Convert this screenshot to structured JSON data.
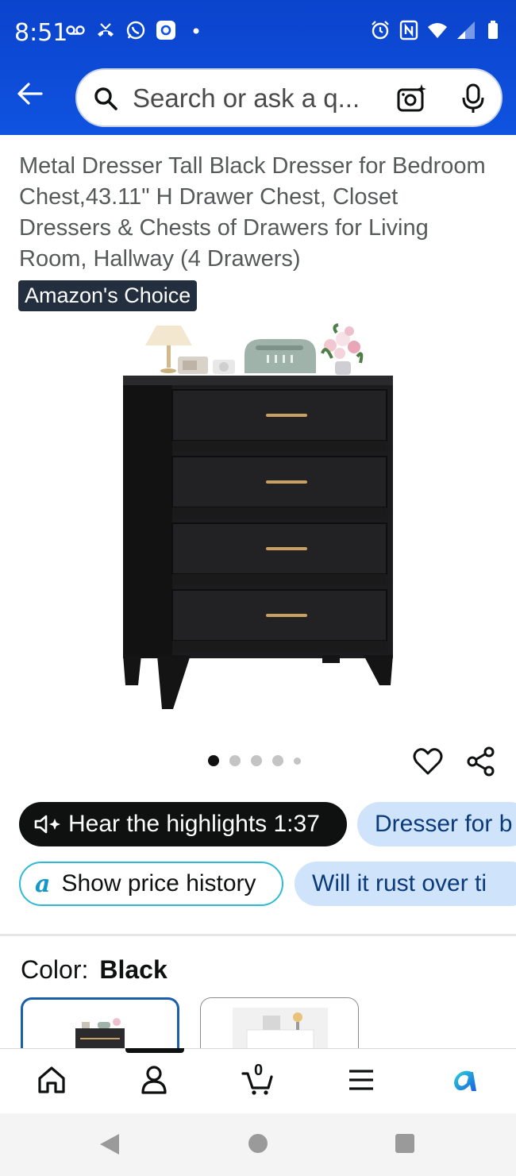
{
  "status_bar": {
    "time": "8:51",
    "left_icons": [
      "voicemail-icon",
      "missed-call-icon",
      "whatsapp-icon",
      "app-notification-icon",
      "dot-icon"
    ],
    "right_icons": [
      "alarm-icon",
      "nfc-icon",
      "wifi-icon",
      "signal-icon",
      "battery-icon"
    ]
  },
  "header": {
    "search_placeholder": "Search or ask a q...",
    "accent_color": "#0f53e0"
  },
  "product": {
    "title": "Metal Dresser Tall Black Dresser for Bedroom Chest,43.11\" H Drawer Chest, Closet Dressers & Chests of Drawers for Living Room, Hallway (4 Drawers)",
    "badge": "Amazon's Choice",
    "image_count": 5,
    "active_image_index": 0
  },
  "pills": {
    "hear_highlights": "Hear the highlights 1:37",
    "dresser_for": "Dresser for b",
    "show_price_history": "Show price history",
    "rust_question": "Will it rust over ti"
  },
  "color_selector": {
    "label": "Color:",
    "value": "Black",
    "options": [
      "Black",
      "White"
    ]
  },
  "bottom_nav": {
    "items": [
      "home-icon",
      "account-icon",
      "cart-icon",
      "menu-icon",
      "rufus-icon"
    ],
    "cart_count": "0",
    "active_item": "account"
  }
}
